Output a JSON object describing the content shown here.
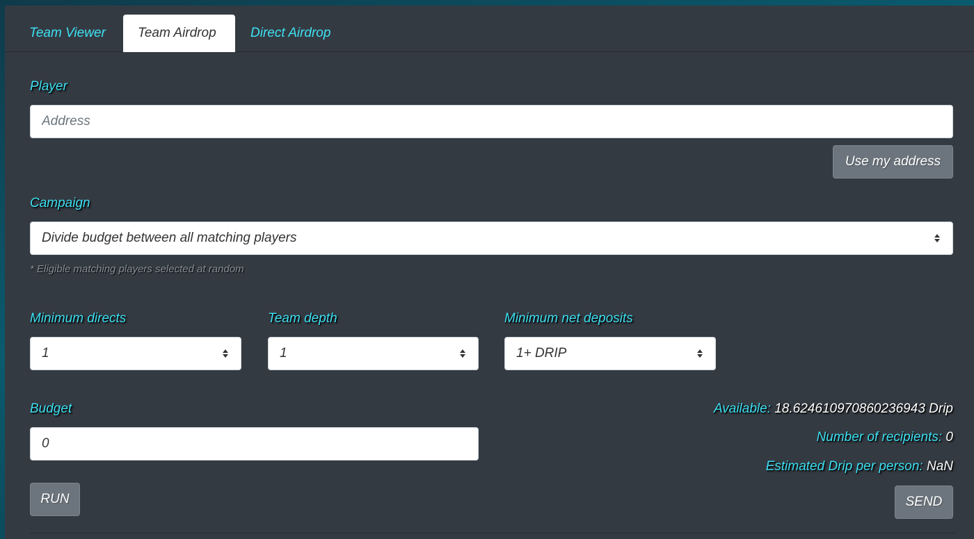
{
  "tabs": [
    {
      "label": "Team Viewer",
      "active": false
    },
    {
      "label": "Team Airdrop",
      "active": true
    },
    {
      "label": "Direct Airdrop",
      "active": false
    }
  ],
  "player": {
    "label": "Player",
    "placeholder": "Address",
    "value": "",
    "use_my_address_label": "Use my address"
  },
  "campaign": {
    "label": "Campaign",
    "selected": "Divide budget between all matching players",
    "hint": "* Eligible matching players selected at random"
  },
  "filters": {
    "min_directs": {
      "label": "Minimum directs",
      "selected": "1"
    },
    "team_depth": {
      "label": "Team depth",
      "selected": "1"
    },
    "min_net_deposits": {
      "label": "Minimum net deposits",
      "selected": "1+ DRIP"
    }
  },
  "budget": {
    "label": "Budget",
    "value": "0",
    "run_label": "RUN"
  },
  "stats": {
    "available_label": "Available:",
    "available_value": "18.624610970860236943 Drip",
    "recipients_label": "Number of recipients:",
    "recipients_value": "0",
    "per_person_label": "Estimated Drip per person:",
    "per_person_value": "NaN",
    "send_label": "SEND"
  },
  "colors": {
    "accent": "#3ee0f2",
    "panel": "#343a42",
    "button": "#6c757d"
  }
}
